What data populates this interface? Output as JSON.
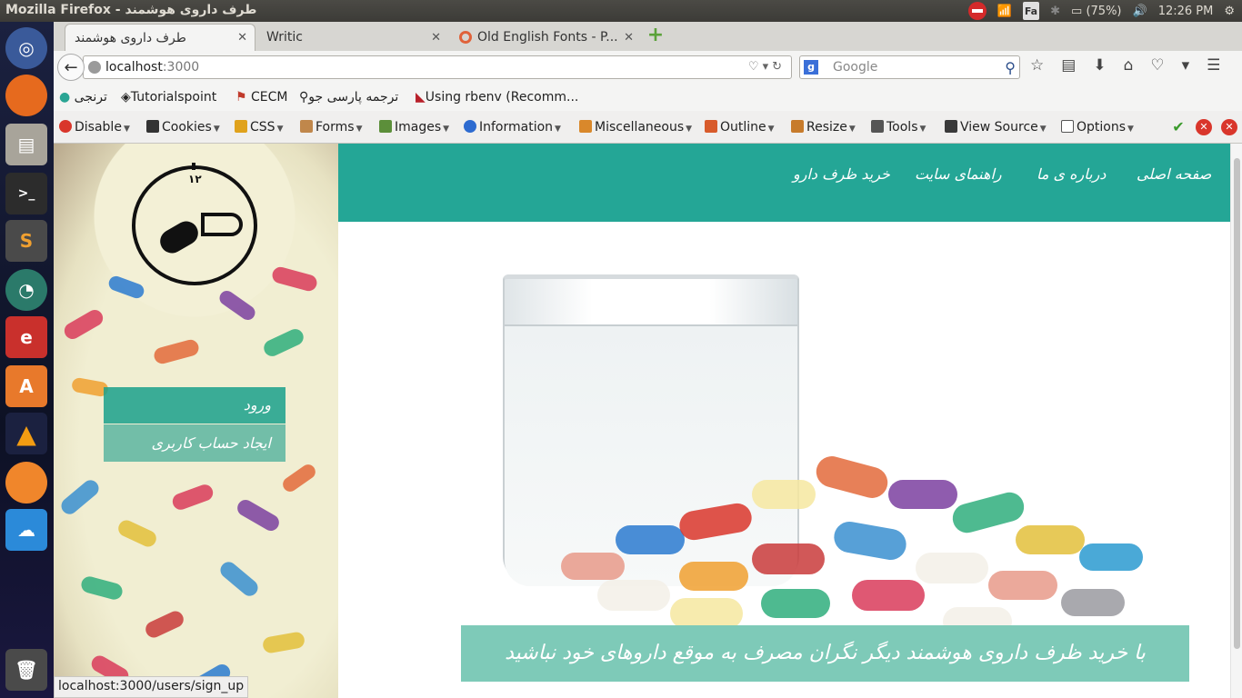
{
  "os": {
    "window_title": "Mozilla Firefox - طرف داروی هوشمند",
    "tray": {
      "keyboard": "Fa",
      "battery": "(75%)",
      "clock": "12:26 PM"
    },
    "launcher": [
      "ubuntu-dash",
      "firefox",
      "file-manager",
      "terminal",
      "sublime-text",
      "network-manager",
      "text-editor",
      "software-center",
      "vlc",
      "orange-app",
      "cloud-download",
      "trash"
    ]
  },
  "tabs": [
    {
      "label": "طرف داروی هوشمند",
      "active": true
    },
    {
      "label": "Writic",
      "active": false
    },
    {
      "label": "Old English Fonts - P...",
      "active": false
    }
  ],
  "urlbar": {
    "host": "localhost",
    "port": ":3000"
  },
  "search": {
    "placeholder": "Google"
  },
  "bookmarks": [
    {
      "label": "ترنجی"
    },
    {
      "label": "Tutorialspoint"
    },
    {
      "label": "CECM"
    },
    {
      "label": "ترجمه پارسی جو"
    },
    {
      "label": "Using rbenv (Recomm..."
    }
  ],
  "devtools": [
    {
      "label": "Disable",
      "color": "#d9362b"
    },
    {
      "label": "Cookies",
      "color": "#333333"
    },
    {
      "label": "CSS",
      "color": "#e0a21c"
    },
    {
      "label": "Forms",
      "color": "#c0874b"
    },
    {
      "label": "Images",
      "color": "#5c8f3a"
    },
    {
      "label": "Information",
      "color": "#2d6bd0"
    },
    {
      "label": "Miscellaneous",
      "color": "#d9882b"
    },
    {
      "label": "Outline",
      "color": "#d85b2b"
    },
    {
      "label": "Resize",
      "color": "#c77b2b"
    },
    {
      "label": "Tools",
      "color": "#555555"
    },
    {
      "label": "View Source",
      "color": "#3a3a3a"
    },
    {
      "label": "Options",
      "color": "#555555"
    }
  ],
  "site": {
    "nav": {
      "home": "صفحه اصلی",
      "about": "درباره ی ما",
      "guide": "راهنمای سایت",
      "buy": "خرید ظرف دارو"
    },
    "clock_number": "۱۲",
    "login": "ورود",
    "signup": "ایجاد حساب کاربری",
    "caption": "با خرید ظرف داروی هوشمند دیگر نگران مصرف به موقع داروهای خود نباشید"
  },
  "status": "localhost:3000/users/sign_up",
  "colors": {
    "teal": "#24a696",
    "caption": "#7ecab8"
  }
}
